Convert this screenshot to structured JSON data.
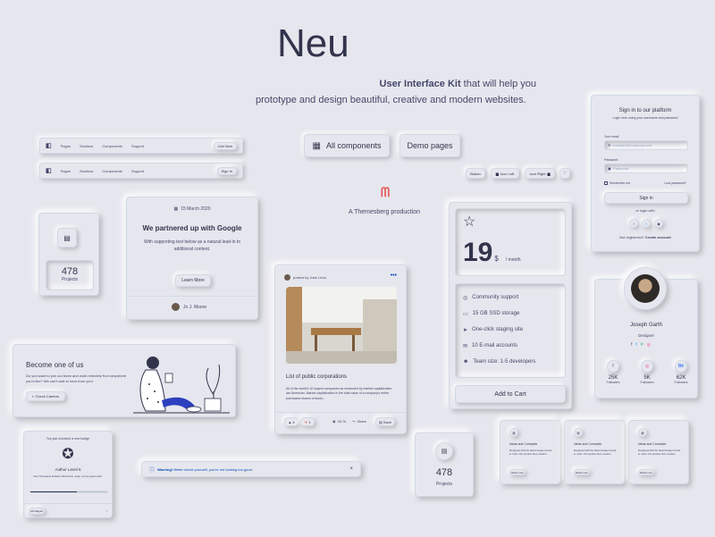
{
  "hero": {
    "title": "Neu",
    "subtitle_bold": "User Interface Kit",
    "subtitle_rest": " that will help you",
    "subtitle_line2": "prototype and design beautiful, creative and modern websites."
  },
  "buttons": {
    "all_components": "All components",
    "demo_pages": "Demo pages",
    "btn_plain": "Button",
    "btn_icon_left": "Icon Left",
    "btn_icon_right": "Icon Right"
  },
  "brand": {
    "production": "A Themesberg production"
  },
  "navbar1": {
    "items": [
      "Pages",
      "Sections",
      "Components",
      "Support"
    ],
    "cta": "Join Now"
  },
  "navbar2": {
    "items": [
      "Pages",
      "Sections",
      "Components",
      "Support"
    ],
    "cta": "Sign In"
  },
  "stat_card": {
    "value": "478",
    "label": "Projects"
  },
  "stat_card2": {
    "value": "478",
    "label": "Projects"
  },
  "google_card": {
    "date": "15 March 2020",
    "title": "We partnered up with Google",
    "body": "With supporting text below as a natural lead-in to additional content.",
    "button": "Learn More",
    "author": "Jo J. Moore"
  },
  "become_card": {
    "title": "Become one of us",
    "body": "Do you want to join our team and work remotely from anywhere you'd like? We can't wait to hear from you!",
    "button": "Check Careers"
  },
  "post_card": {
    "author": "posted by Jose Leos",
    "title": "List of public corporations",
    "body": "All of the world's 10 largest companies as measured by market capitalization are American. Market capitalization is the total value of a company's entire purchased shares of stock...",
    "likes": "4",
    "dislikes": "1",
    "views": "33.7k",
    "share": "Share",
    "save": "Save"
  },
  "pricing": {
    "price": "19",
    "currency": "$",
    "period": "/ month",
    "features": [
      "Community support",
      "15 GB SSD storage",
      "One-click staging site",
      "10 E-mail accounts",
      "Team size: 1-5 developers"
    ],
    "cta": "Add to Cart"
  },
  "signin": {
    "title": "Sign in to our platform",
    "subtitle": "Login here using your username and password",
    "email_label": "Your email",
    "email_placeholder": "example@company.com",
    "password_label": "Password",
    "password_placeholder": "Password",
    "remember": "Remember me",
    "lost": "Lost password?",
    "button": "Sign in",
    "or": "or login with",
    "not_registered": "Not registered?",
    "create": "Create account"
  },
  "profile": {
    "name": "Joseph Garth",
    "role": "Designer",
    "stats": [
      {
        "value": "25K",
        "label": "Followers",
        "icon": "facebook-icon",
        "color": "#3b5999"
      },
      {
        "value": "5K",
        "label": "Followers",
        "icon": "dribbble-icon",
        "color": "#ea4c89"
      },
      {
        "value": "62K",
        "label": "Followers",
        "icon": "behance-icon",
        "color": "#0057ff"
      }
    ]
  },
  "badge_card": {
    "text": "You just unlocked a new badge",
    "level": "Author Level 5",
    "desc": "One Thousand Dollars! Well done, keep up the good work.",
    "button": "All badges",
    "progress": 0.6
  },
  "alert": {
    "strong": "Warning!",
    "text": " Better check yourself, you're not looking too good."
  },
  "mini_cards": [
    {
      "title": "Ideas and Concepts",
      "body": "Designed with the latest design trends in mind. Our product fires modern.",
      "button": "Read more"
    },
    {
      "title": "Ideas and Concepts",
      "body": "Designed with the latest design trends in mind. Our product fires modern.",
      "button": "Read more"
    },
    {
      "title": "Ideas and Concepts",
      "body": "Designed with the latest design trends in mind. Our product fires modern.",
      "button": "Read more"
    }
  ],
  "colors": {
    "bg": "#e6e7ee",
    "text": "#44476a",
    "brand_red": "#e65a5a",
    "accent": "#0948b3"
  }
}
